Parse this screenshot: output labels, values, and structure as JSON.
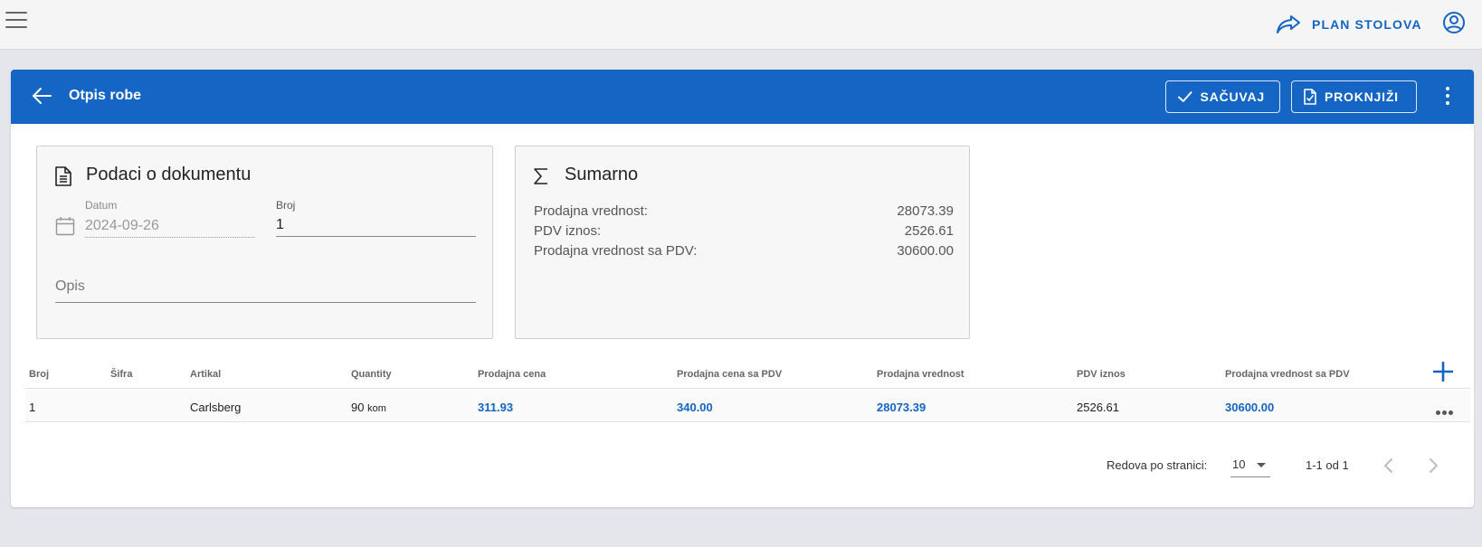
{
  "topbar": {
    "menu_icon": "hamburger-icon",
    "plan_link_label": "PLAN STOLOVA",
    "plan_link_icon": "share-forward-icon",
    "account_icon": "account-circle-icon"
  },
  "header": {
    "title": "Otpis robe",
    "save_label": "SAČUVAJ",
    "book_label": "PROKNJIŽI",
    "background_color": "#1565c4"
  },
  "document_panel": {
    "title": "Podaci o dokumentu",
    "date_label": "Datum",
    "date_value": "2024-09-26",
    "number_label": "Broj",
    "number_value": "1",
    "description_label": "Opis"
  },
  "summary_panel": {
    "title": "Sumarno",
    "rows": [
      {
        "label": "Prodajna vrednost:",
        "value": "28073.39"
      },
      {
        "label": "PDV iznos:",
        "value": "2526.61"
      },
      {
        "label": "Prodajna vrednost sa PDV:",
        "value": "30600.00"
      }
    ]
  },
  "table": {
    "columns": [
      "Broj",
      "Šifra",
      "Artikal",
      "Quantity",
      "Prodajna cena",
      "Prodajna cena sa PDV",
      "Prodajna vrednost",
      "PDV iznos",
      "Prodajna vrednost sa PDV"
    ],
    "rows": [
      {
        "broj": "1",
        "sifra": "",
        "artikal": "Carlsberg",
        "quantity": "90",
        "unit": "kom",
        "prodajna_cena": "311.93",
        "prodajna_cena_pdv": "340.00",
        "prodajna_vrednost": "28073.39",
        "pdv_iznos": "2526.61",
        "prodajna_vrednost_pdv": "30600.00"
      }
    ]
  },
  "pagination": {
    "rows_per_page_label": "Redova po stranici:",
    "rows_per_page_value": "10",
    "range": "1-1 od 1"
  }
}
